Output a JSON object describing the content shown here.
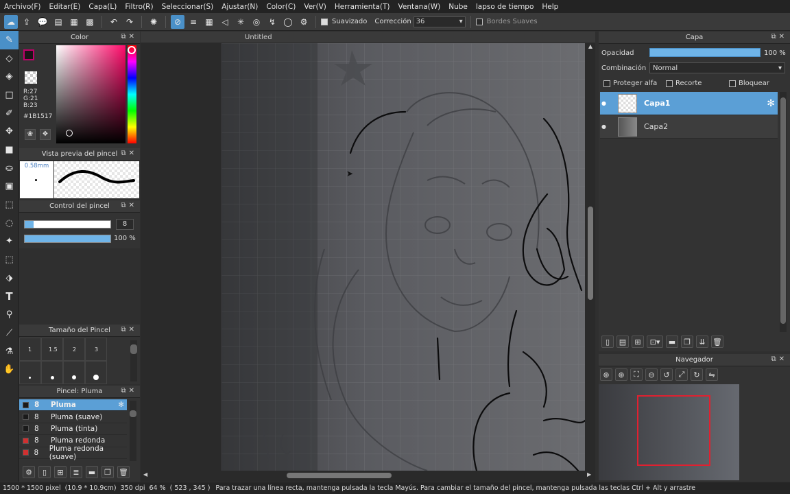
{
  "menubar": {
    "items": [
      "Archivo(F)",
      "Editar(E)",
      "Capa(L)",
      "Filtro(R)",
      "Seleccionar(S)",
      "Ajustar(N)",
      "Color(C)",
      "Ver(V)",
      "Herramienta(T)",
      "Ventana(W)",
      "Nube",
      "lapso de tiempo",
      "Help"
    ]
  },
  "toolbar": {
    "smoothing_label": "Suavizado",
    "correction_label": "Corrección",
    "correction_value": "36",
    "soft_edges_label": "Bordes Suaves"
  },
  "color_panel": {
    "title": "Color",
    "r": "R:27",
    "g": "G:21",
    "b": "B:23",
    "hex": "#1B1517",
    "foreground": "#1B1517",
    "accent": "#c0006a"
  },
  "brush_preview": {
    "title": "Vista previa del pincel",
    "size_label": "0.58mm"
  },
  "brush_control": {
    "title": "Control del pincel",
    "size_value": "8",
    "opacity_value": "100 %",
    "size_fraction": 0.1,
    "opacity_fraction": 1.0
  },
  "brush_size": {
    "title": "Tamaño del Pincel",
    "labels": [
      "1",
      "1.5",
      "2",
      "3"
    ]
  },
  "brush_list": {
    "title": "Pincel: Pluma",
    "items": [
      {
        "size": "8",
        "name": "Pluma",
        "color": "#1a1a1a"
      },
      {
        "size": "8",
        "name": "Pluma (suave)",
        "color": "#1a1a1a"
      },
      {
        "size": "8",
        "name": "Pluma (tinta)",
        "color": "#1a1a1a"
      },
      {
        "size": "8",
        "name": "Pluma redonda",
        "color": "#d03030"
      },
      {
        "size": "8",
        "name": "Pluma redonda (suave)",
        "color": "#d03030"
      }
    ]
  },
  "canvas": {
    "tab_title": "Untitled"
  },
  "layer_panel": {
    "title": "Capa",
    "opacity_label": "Opacidad",
    "opacity_value": "100 %",
    "blend_label": "Combinación",
    "blend_value": "Normal",
    "protect_alpha": "Proteger alfa",
    "clipping": "Recorte",
    "lock": "Bloquear",
    "layers": [
      "Capa1",
      "Capa2"
    ]
  },
  "navigator": {
    "title": "Navegador"
  },
  "status": {
    "dimensions": "1500 * 1500 pixel",
    "physical": "(10.9 * 10.9cm)",
    "dpi": "350 dpi",
    "zoom": "64 %",
    "cursor": "( 523 , 345 )",
    "hint": "Para trazar una línea recta, mantenga pulsada la tecla Mayús. Para cambiar el tamaño del pincel, mantenga pulsada las teclas Ctrl + Alt y arrastre"
  }
}
